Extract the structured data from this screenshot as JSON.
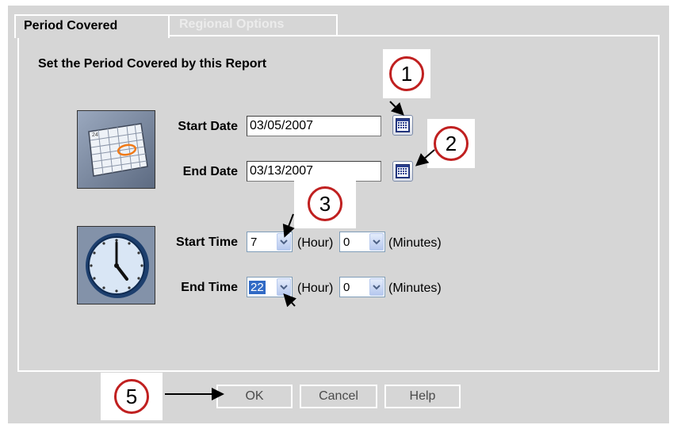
{
  "tabs": [
    {
      "label": "Period Covered",
      "active": true
    },
    {
      "label": "Regional Options",
      "active": false
    }
  ],
  "section_title": "Set the Period Covered by this Report",
  "start_date": {
    "label": "Start Date",
    "value": "03/05/2007"
  },
  "end_date": {
    "label": "End Date",
    "value": "03/13/2007"
  },
  "start_time": {
    "label": "Start Time",
    "hour": "7",
    "minutes": "0"
  },
  "end_time": {
    "label": "End Time",
    "hour": "22",
    "minutes": "0"
  },
  "units": {
    "hour": "(Hour)",
    "minutes": "(Minutes)"
  },
  "buttons": {
    "ok": "OK",
    "cancel": "Cancel",
    "help": "Help"
  },
  "callouts": {
    "one": "1",
    "two": "2",
    "three": "3",
    "five": "5"
  },
  "icons": {
    "calendar_picture": "calendar-picture-icon",
    "clock_picture": "clock-picture-icon",
    "calendar_button": "calendar-icon",
    "dropdown": "chevron-down-icon"
  },
  "colors": {
    "dialog_bg": "#d6d6d6",
    "callout_ring": "#c02020",
    "selection": "#316ac5"
  }
}
